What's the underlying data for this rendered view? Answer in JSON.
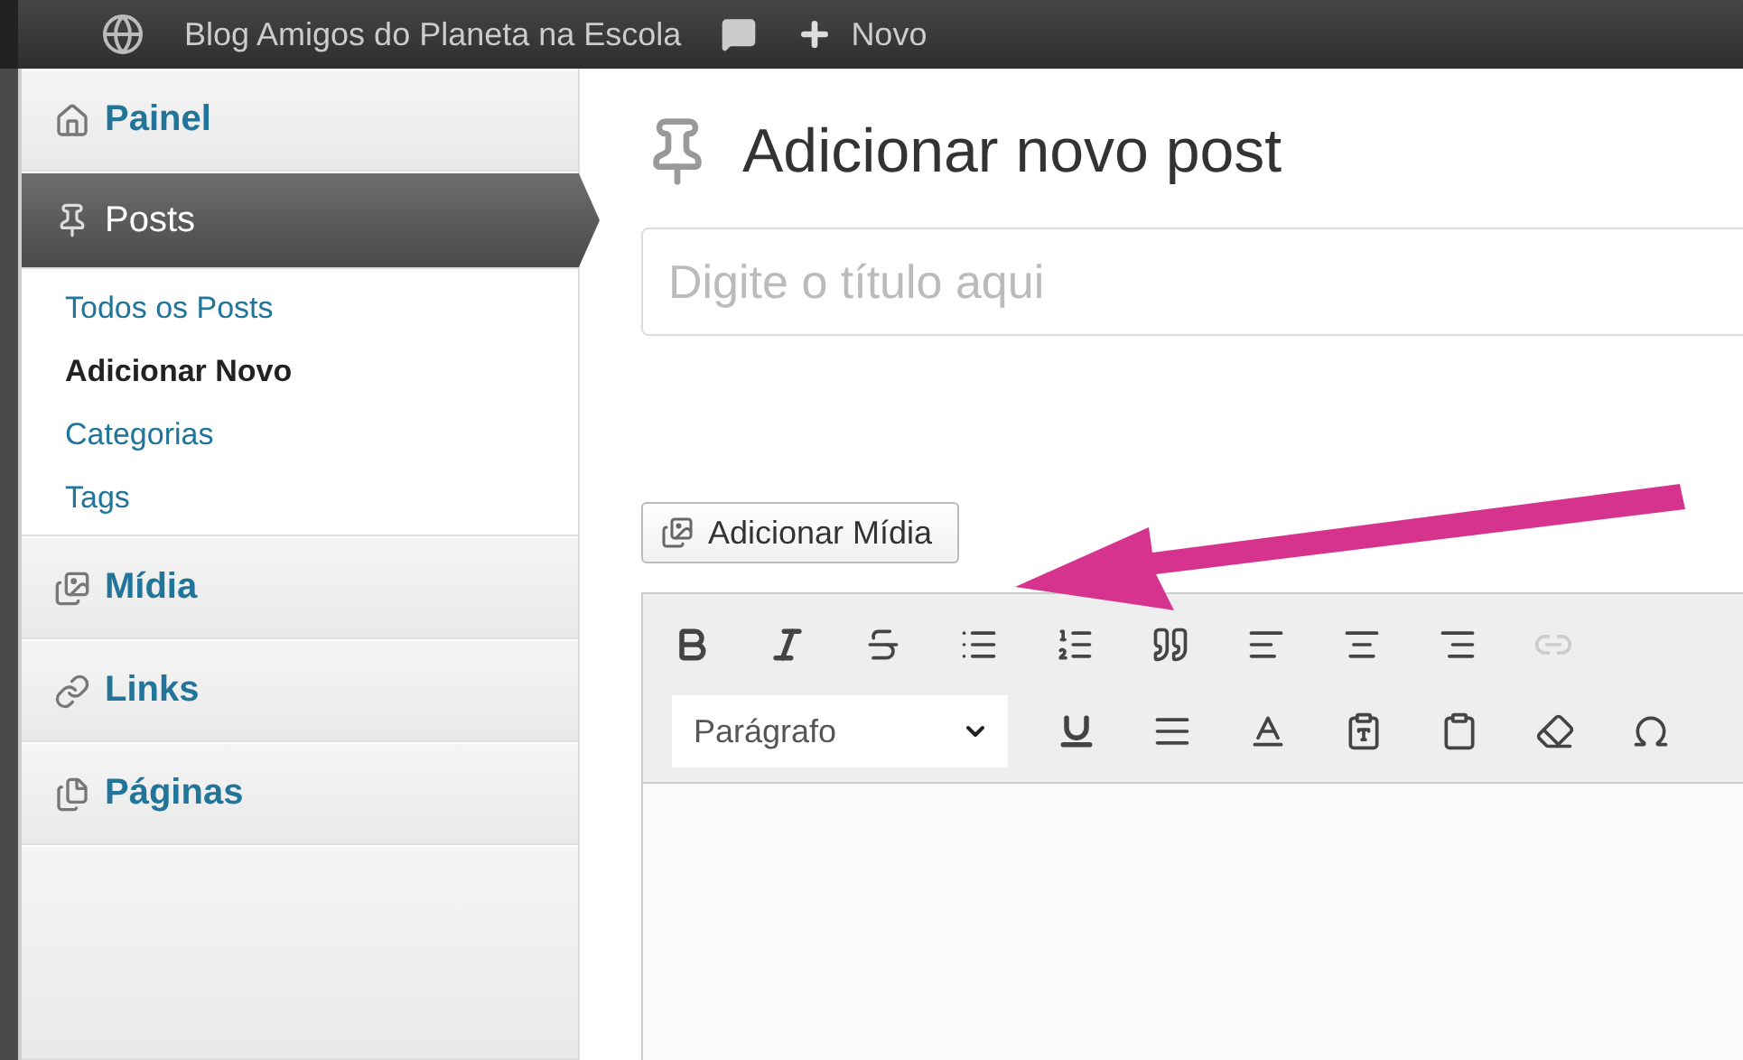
{
  "admin_bar": {
    "site_name": "Blog Amigos do Planeta na Escola",
    "new_label": "Novo"
  },
  "sidebar": {
    "items": [
      {
        "label": "Painel",
        "selected": false
      },
      {
        "label": "Posts",
        "selected": true,
        "children": [
          {
            "label": "Todos os Posts",
            "selected": false
          },
          {
            "label": "Adicionar Novo",
            "selected": true
          },
          {
            "label": "Categorias",
            "selected": false
          },
          {
            "label": "Tags",
            "selected": false
          }
        ]
      },
      {
        "label": "Mídia",
        "selected": false
      },
      {
        "label": "Links",
        "selected": false
      },
      {
        "label": "Páginas",
        "selected": false
      }
    ]
  },
  "page": {
    "title": "Adicionar novo post",
    "title_field": {
      "placeholder": "Digite o título aqui"
    },
    "media_button": "Adicionar Mídia",
    "editor": {
      "format_select": "Parágrafo"
    }
  }
}
